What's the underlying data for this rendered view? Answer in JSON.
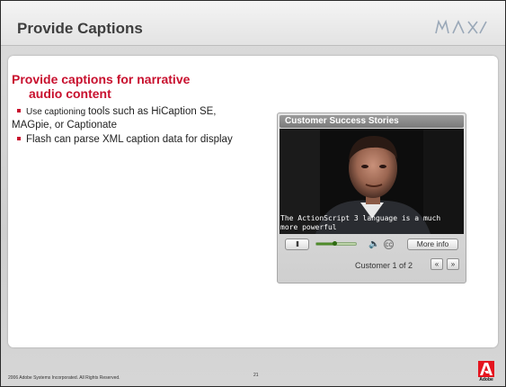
{
  "slide": {
    "title": "Provide Captions",
    "logo": {
      "name": "max-logo",
      "text": "MAX"
    }
  },
  "content": {
    "heading_line1": "Provide captions for narrative",
    "heading_line2": "audio content",
    "bullets": [
      {
        "lead": "Use captioning ",
        "rest": "tools such as HiCaption SE, MAGpie, or Captionate"
      },
      {
        "lead": "",
        "rest": "Flash can parse XML caption data for display"
      }
    ]
  },
  "player": {
    "header": "Customer Success Stories",
    "caption_line1": "The ActionScript 3 language is a much",
    "caption_line2": "more powerful",
    "pause_label": "II",
    "volume_icon": "speaker-icon",
    "cc_icon": "cc-icon",
    "more_info_label": "More info",
    "customer_label": "Customer 1 of 2",
    "prev_label": "«",
    "next_label": "»",
    "progress": 0.45,
    "colors": {
      "header": "#888888",
      "video_bg": "#0a0a0a",
      "track": "#bcd3a9"
    }
  },
  "footer": {
    "copyright": "2006 Adobe Systems Incorporated.  All Rights Reserved.",
    "page_number": "21",
    "brand": "Adobe"
  },
  "colors": {
    "accent": "#c8102e"
  }
}
